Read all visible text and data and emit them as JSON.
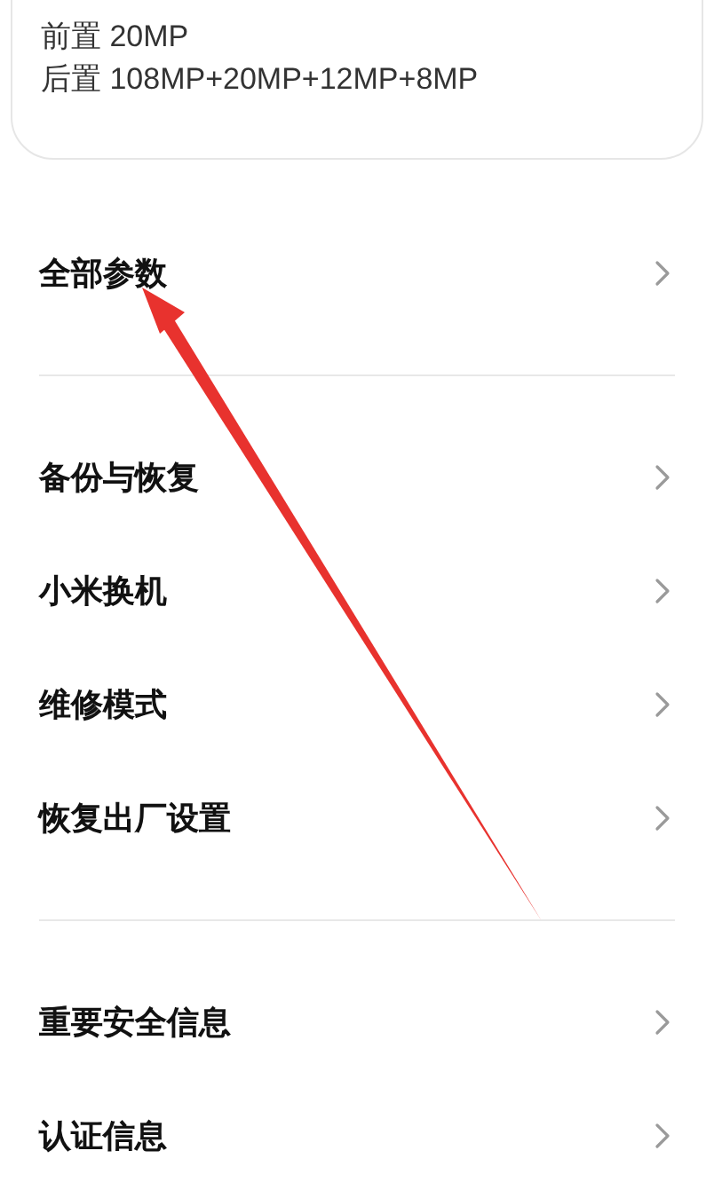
{
  "camera_card": {
    "lines": [
      "前置 20MP",
      "后置 108MP+20MP+12MP+8MP"
    ]
  },
  "sections": [
    {
      "items": [
        {
          "label": "全部参数"
        }
      ]
    },
    {
      "items": [
        {
          "label": "备份与恢复"
        },
        {
          "label": "小米换机"
        },
        {
          "label": "维修模式"
        },
        {
          "label": "恢复出厂设置"
        }
      ]
    },
    {
      "items": [
        {
          "label": "重要安全信息"
        },
        {
          "label": "认证信息"
        }
      ]
    }
  ],
  "annotation": {
    "kind": "arrow"
  }
}
